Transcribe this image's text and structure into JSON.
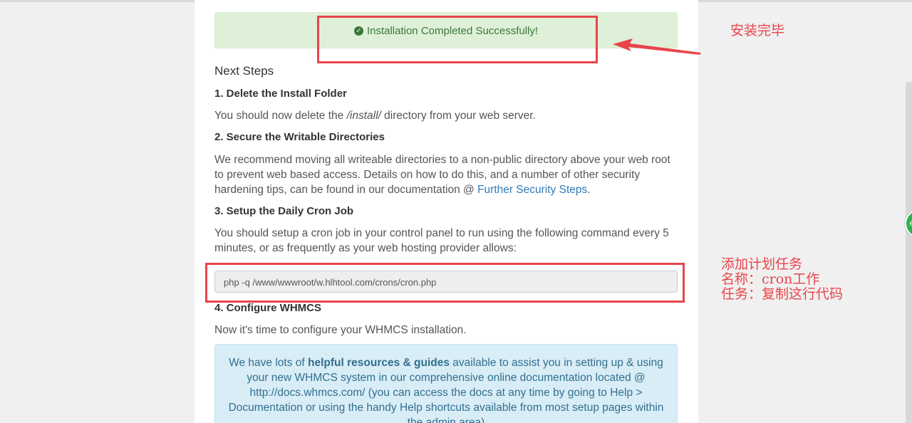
{
  "success": {
    "text": "Installation Completed Successfully!",
    "icon": "check-circle-icon"
  },
  "next_steps": {
    "title": "Next Steps"
  },
  "steps": [
    {
      "heading": "1. Delete the Install Folder",
      "text_before": "You should now delete the ",
      "text_em": "/install/",
      "text_after": " directory from your web server."
    },
    {
      "heading": "2. Secure the Writable Directories",
      "text": "We recommend moving all writeable directories to a non-public directory above your web root to prevent web based access. Details on how to do this, and a number of other security hardening tips, can be found in our documentation @ ",
      "link": "Further Security Steps",
      "text_after": "."
    },
    {
      "heading": "3. Setup the Daily Cron Job",
      "text": "You should setup a cron job in your control panel to run using the following command every 5 minutes, or as frequently as your web hosting provider allows:",
      "command": "php -q /www/wwwroot/w.hlhtool.com/crons/cron.php"
    },
    {
      "heading": "4. Configure WHMCS",
      "text": "Now it's time to configure your WHMCS installation."
    }
  ],
  "info": {
    "part1": "We have lots of ",
    "bold": "helpful resources & guides",
    "part2": " available to assist you in setting up & using your new WHMCS system in our comprehensive online documentation located @ ",
    "link": "http://docs.whmcs.com/",
    "part3": " (you can access the docs at any time by going to Help > Documentation or using the handy Help shortcuts available from most setup pages within the admin area)"
  },
  "annotations": {
    "complete": "安装完毕",
    "cron_line1": "添加计划任务",
    "cron_line2": "名称：cron工作",
    "cron_line3": "任务：复制这行代码"
  },
  "colors": {
    "annotation_red": "#e8454b",
    "success_green": "#3c763d",
    "link_blue": "#337ab7",
    "info_blue": "#31708f"
  }
}
